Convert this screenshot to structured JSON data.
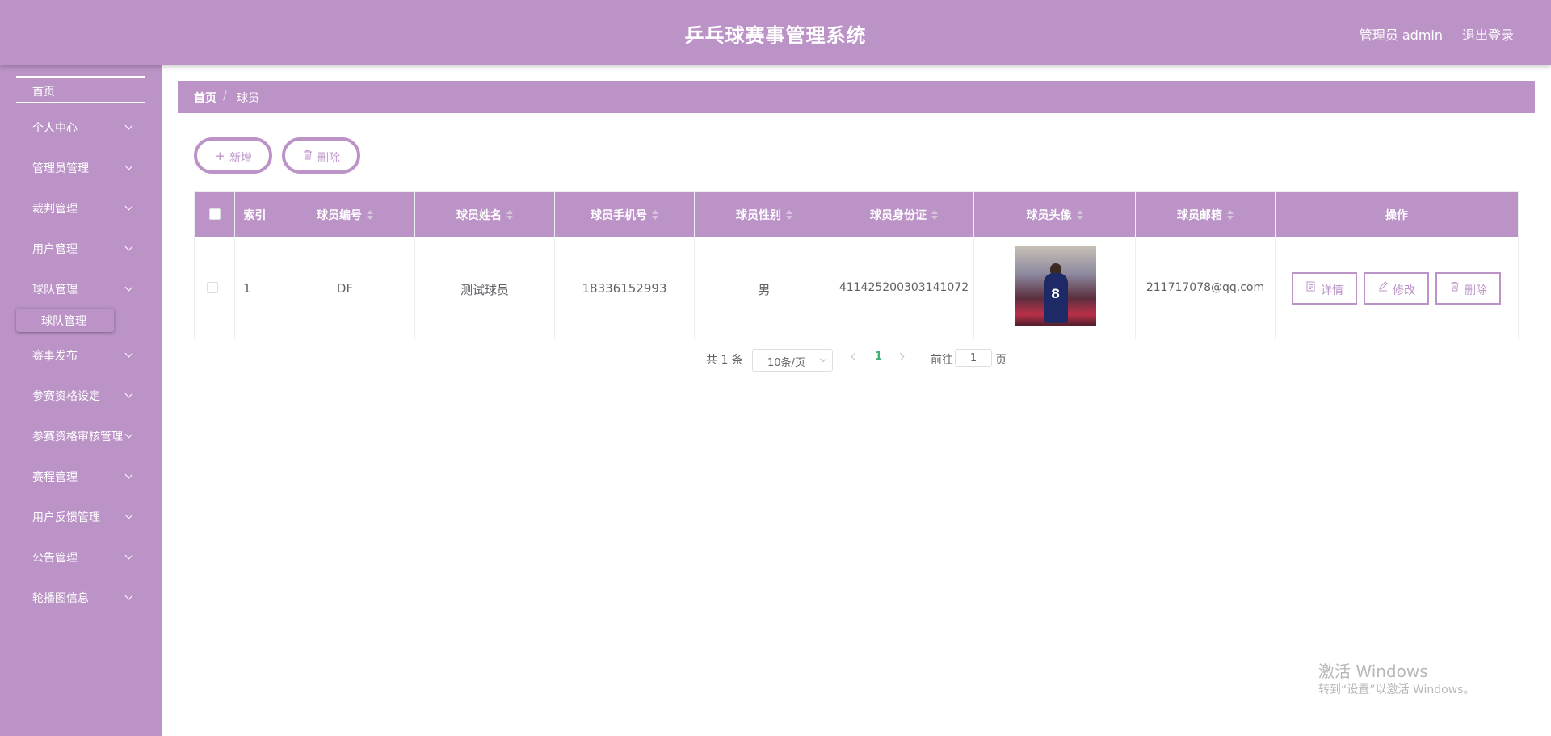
{
  "header": {
    "title": "乒乓球赛事管理系统",
    "admin": "管理员 admin",
    "logout": "退出登录"
  },
  "sidebar": {
    "home": "首页",
    "items": [
      {
        "label": "个人中心"
      },
      {
        "label": "管理员管理"
      },
      {
        "label": "裁判管理"
      },
      {
        "label": "用户管理"
      },
      {
        "label": "球队管理"
      },
      {
        "label": "赛事发布"
      },
      {
        "label": "参赛资格设定"
      },
      {
        "label": "参赛资格审核管理"
      },
      {
        "label": "赛程管理"
      },
      {
        "label": "用户反馈管理"
      },
      {
        "label": "公告管理"
      },
      {
        "label": "轮播图信息"
      }
    ],
    "active_sub": "球队管理"
  },
  "breadcrumb": {
    "home": "首页",
    "separator": "/",
    "current": "球员"
  },
  "toolbar": {
    "add_icon": "+",
    "add_label": "新增",
    "delete_label": "删除"
  },
  "table": {
    "columns": {
      "index": "索引",
      "player_no": "球员编号",
      "name": "球员姓名",
      "phone": "球员手机号",
      "gender": "球员性别",
      "id_card": "球员身份证",
      "avatar": "球员头像",
      "email": "球员邮箱",
      "actions": "操作"
    },
    "rows": [
      {
        "index": "1",
        "player_no": "DF",
        "name": "测试球员",
        "phone": "18336152993",
        "gender": "男",
        "id_card": "411425200303141072",
        "avatar_jersey": "8",
        "email": "211717078@qq.com"
      }
    ],
    "actions": {
      "detail": "详情",
      "edit": "修改",
      "delete": "删除"
    }
  },
  "pagination": {
    "total": "共 1 条",
    "page_size": "10条/页",
    "current_page": "1",
    "goto_label": "前往",
    "goto_value": "1",
    "goto_suffix": "页"
  },
  "watermark": {
    "line1": "激活 Windows",
    "line2": "转到“设置”以激活 Windows。"
  },
  "colors": {
    "accent": "#bb93c7",
    "active_page": "#3cb371"
  }
}
